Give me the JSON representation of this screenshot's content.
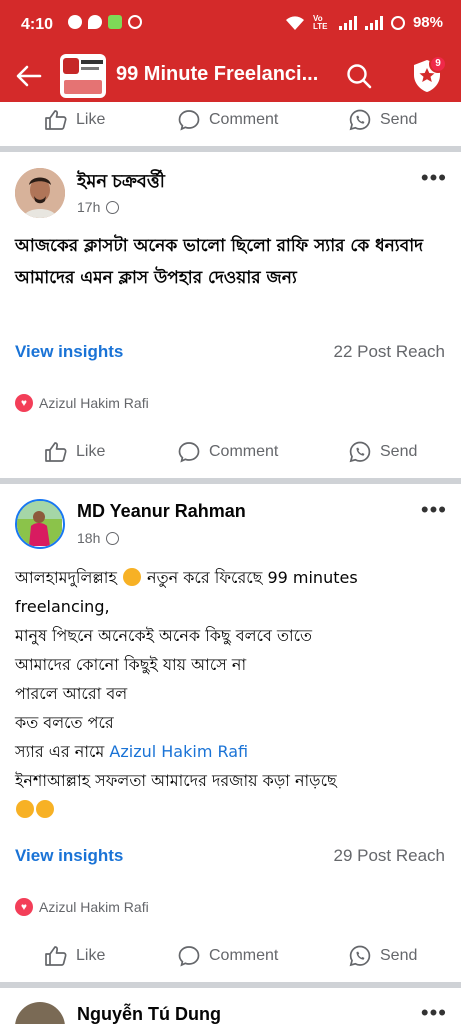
{
  "status_bar": {
    "time": "4:10",
    "battery": "98%",
    "network": "Vo LTE"
  },
  "app_bar": {
    "title": "99 Minute Freelanci...",
    "notification_count": "9"
  },
  "actions": {
    "like": "Like",
    "comment": "Comment",
    "send": "Send"
  },
  "posts": [
    {
      "author": "ইমন চক্রবর্ত্তী",
      "time": "17h",
      "text": "আজকের ক্লাসটা অনেক ভালো ছিলো রাফি স্যার কে ধন্যবাদ আমাদের এমন ক্লাস উপহার দেওয়ার জন্য",
      "insights": "View insights",
      "reach": "22 Post Reach",
      "reactor": "Azizul Hakim Rafi"
    },
    {
      "author": "MD Yeanur Rahman",
      "time": "18h",
      "lines": [
        "আলহামদুলিল্লাহ",
        "নতুন করে ফিরেছে 99 minutes",
        "freelancing,",
        "মানুষ পিছনে অনেকেই অনেক কিছু বলবে তাতে",
        "আমাদের কোনো কিছুই যায় আসে না",
        "পারলে আরো বল",
        "কত বলতে পরে",
        "স্যার এর নামে",
        "Azizul Hakim Rafi",
        "ইনশাআল্লাহ সফলতা আমাদের দরজায় কড়া নাড়ছে"
      ],
      "insights": "View insights",
      "reach": "29 Post Reach",
      "reactor": "Azizul Hakim Rafi"
    },
    {
      "author": "Nguyễn Tú Dung"
    }
  ],
  "colors": {
    "brand": "#d42a2a",
    "link": "#1a73d6",
    "muted": "#65676b"
  }
}
